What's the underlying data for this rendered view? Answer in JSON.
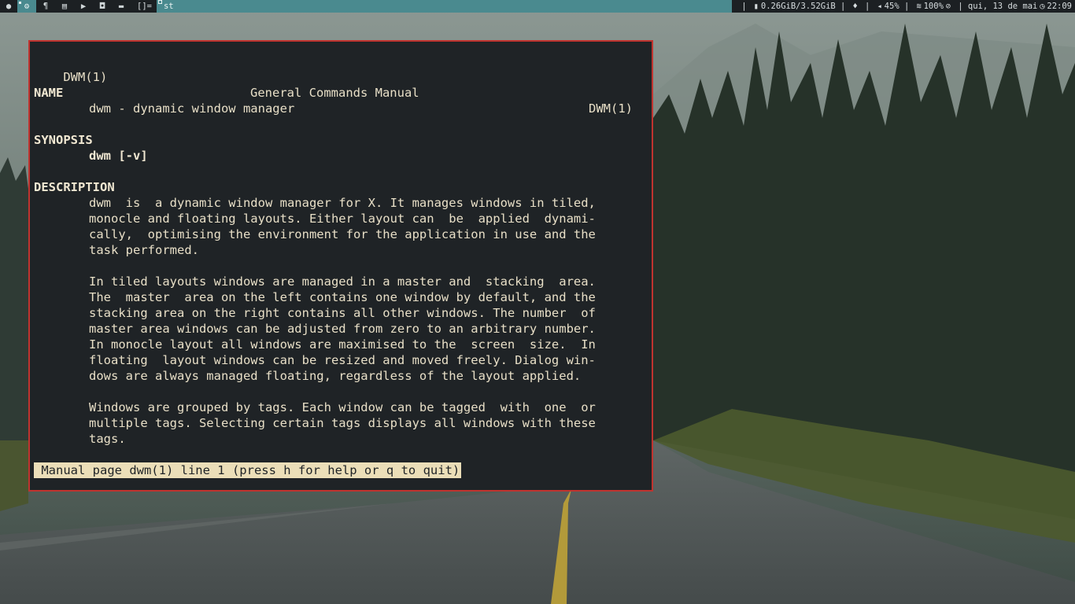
{
  "bar": {
    "tags": [
      {
        "name": "tag-web",
        "icon": "globe-icon",
        "glyph": "●"
      },
      {
        "name": "tag-settings",
        "icon": "gear-icon",
        "glyph": "⚙"
      },
      {
        "name": "tag-text",
        "icon": "paragraph-icon",
        "glyph": "¶"
      },
      {
        "name": "tag-files",
        "icon": "archive-icon",
        "glyph": "▤"
      },
      {
        "name": "tag-media",
        "icon": "play-icon",
        "glyph": "▶"
      },
      {
        "name": "tag-games",
        "icon": "gamepad-icon",
        "glyph": "◘"
      },
      {
        "name": "tag-chat",
        "icon": "chat-icon",
        "glyph": "▬"
      }
    ],
    "layout": "[]=",
    "window_title": "st",
    "status": {
      "memory": "0.26GiB/3.52GiB",
      "volume": "45%",
      "wifi": "100%",
      "date": "qui, 13 de mai",
      "time": "22:09"
    },
    "accent_color": "#4a8a8f"
  },
  "terminal": {
    "border_color": "#c0332f",
    "header_left": "DWM(1)",
    "header_center": "General Commands Manual",
    "header_right": "DWM(1)",
    "name_heading": "NAME",
    "name_text": "dwm - dynamic window manager",
    "synopsis_heading": "SYNOPSIS",
    "synopsis_text": "dwm [-v]",
    "description_heading": "DESCRIPTION",
    "para1": [
      "dwm  is  a dynamic window manager for X. It manages windows in tiled,",
      "monocle and floating layouts. Either layout can  be  applied  dynami-",
      "cally,  optimising the environment for the application in use and the",
      "task performed."
    ],
    "para2": [
      "In tiled layouts windows are managed in a master and  stacking  area.",
      "The  master  area on the left contains one window by default, and the",
      "stacking area on the right contains all other windows. The number  of",
      "master area windows can be adjusted from zero to an arbitrary number.",
      "In monocle layout all windows are maximised to the  screen  size.  In",
      "floating  layout windows can be resized and moved freely. Dialog win-",
      "dows are always managed floating, regardless of the layout applied."
    ],
    "para3": [
      "Windows are grouped by tags. Each window can be tagged  with  one  or",
      "multiple tags. Selecting certain tags displays all windows with these",
      "tags."
    ],
    "status_line": " Manual page dwm(1) line 1 (press h for help or q to quit)"
  }
}
